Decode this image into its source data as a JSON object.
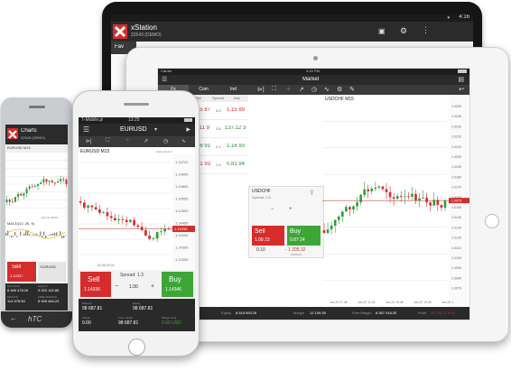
{
  "tablet_back": {
    "status_time": "4:16",
    "app_title": "xStation",
    "account": "22543 (DEMO)",
    "fav_label": "Fav"
  },
  "ipad": {
    "carrier": "Carrier",
    "time": "3:43 PM",
    "title": "Market",
    "tabs": [
      "Fx",
      "Com",
      "Ind"
    ],
    "symbol": "USDCHF M15",
    "columns": [
      "Bid",
      "Spread",
      "Ask"
    ],
    "rows": [
      {
        "bid": "1.15 87",
        "spread": "0.5",
        "ask": "1.15 89"
      },
      {
        "bid": "137.11 9",
        "spread": "3.8",
        "ask": "137.12 3"
      },
      {
        "bid": "1.16 91",
        "spread": "2.1",
        "ask": "1.16 93"
      },
      {
        "bid": "0.81 93",
        "spread": "1.3",
        "ask": "0.81 94"
      }
    ],
    "trade_symbol": "USDCHF",
    "spread_label": "Spread: 1.6",
    "volume": "0.10",
    "sell": {
      "label": "Sell",
      "price": "1.08 23"
    },
    "buy": {
      "label": "Buy",
      "price": "0.87 24"
    },
    "pnl": "- 1 295.32",
    "pnl_sub": "2052618",
    "bottom_bar": [
      {
        "label": "Equity",
        "value": "8 615 693.26"
      },
      {
        "label": "Margin",
        "value": "12 109.55"
      },
      {
        "label": "Free Margin",
        "value": "8 587 018.05"
      },
      {
        "label": "Profit",
        "value": "26 745.21 PLN"
      }
    ],
    "x_ticks": [
      "Jan 20 07:45",
      "Jan 20 11:45",
      "Jan 20 15:45",
      "Jan 20 19:45",
      "Jan 20 1"
    ],
    "price_ticks": [
      "1.0250",
      "1.0240",
      "1.0230",
      "1.0220",
      "1.0210",
      "1.0200",
      "1.0190",
      "1.0180",
      "1.0170",
      "1.0160",
      "1.0150",
      "1.0140",
      "1.0130",
      "1.0120",
      "1.0110",
      "1.0100",
      "1.0090",
      "1.0080",
      "1.0070"
    ],
    "last_price": "1.0075"
  },
  "android": {
    "title": "Charts",
    "account": "22543 (DEMO)",
    "symbol": "EURUSD M15",
    "indicator": "MACD(12, 26, 9)",
    "tick_label": "Dec 24 15:00",
    "sell": {
      "label": "Sell",
      "price": "1.14337"
    },
    "instrument": "EURUSD",
    "stats": [
      {
        "label": "BALANCE",
        "value": "8 489 478.26"
      },
      {
        "label": "EQUITY",
        "value": "9 020 162.86"
      },
      {
        "label": "MARGIN",
        "value": "114 678.59"
      },
      {
        "label": "FREE MARGIN",
        "value": "8 905 484.23"
      }
    ],
    "brand": "hTC"
  },
  "iphone": {
    "carrier": "T-Mobile.pl",
    "time": "13:25",
    "instrument": "EURUSD",
    "chart_symbol": "EURUSD M15",
    "auto_scroll": "Auto-scroll on",
    "price_ticks": [
      "1.14720",
      "1.14650",
      "1.14600",
      "1.14550",
      "1.14500",
      "1.14450",
      "1.14400",
      "1.14350",
      "1.14300"
    ],
    "current_price": "1.14335",
    "x_tick": "Jul 08 09:30",
    "sell": {
      "label": "Sell",
      "price": "1.14335"
    },
    "buy": {
      "label": "Buy",
      "price": "1.14346"
    },
    "spread": "Spread: 1.3",
    "volume": "1.00",
    "stats": [
      {
        "label": "Balance",
        "value": "98 687.81"
      },
      {
        "label": "Equity",
        "value": "98 687.81"
      },
      {
        "label": "Margin",
        "value": "0.00"
      },
      {
        "label": "Free margin",
        "value": "98 687.81"
      },
      {
        "label": "Margin level",
        "value": "0.00 USD"
      }
    ]
  },
  "colors": {
    "red": "#d62c2c",
    "green": "#3ea636",
    "dark": "#1e1e1e",
    "header": "#3a3a3a"
  }
}
